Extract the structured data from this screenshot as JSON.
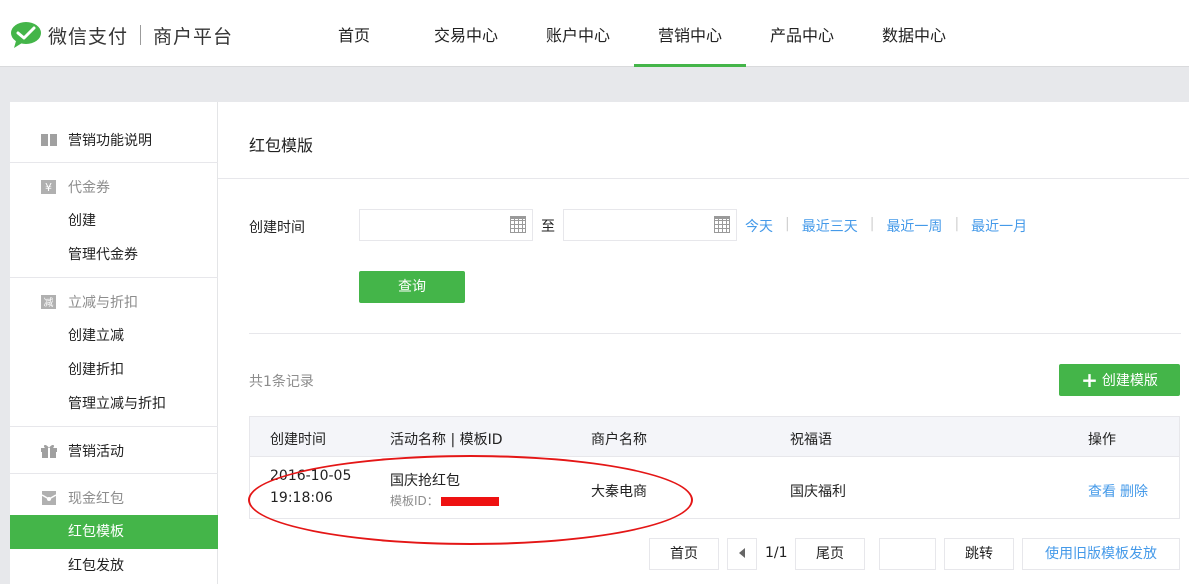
{
  "header": {
    "brand": "微信支付",
    "subtitle": "商户平台",
    "nav": [
      {
        "label": "首页"
      },
      {
        "label": "交易中心"
      },
      {
        "label": "账户中心"
      },
      {
        "label": "营销中心"
      },
      {
        "label": "产品中心"
      },
      {
        "label": "数据中心"
      }
    ],
    "active_nav": "营销中心"
  },
  "sidebar": {
    "marketing_intro": "营销功能说明",
    "voucher": {
      "title": "代金券",
      "items": [
        "创建",
        "管理代金券"
      ]
    },
    "discount": {
      "title": "立减与折扣",
      "items": [
        "创建立减",
        "创建折扣",
        "管理立减与折扣"
      ]
    },
    "activity": "营销活动",
    "cash_redpack": {
      "title": "现金红包",
      "items": [
        "红包模板",
        "红包发放"
      ]
    },
    "active_item": "红包模板"
  },
  "main": {
    "title": "红包模版",
    "filter": {
      "label": "创建时间",
      "start_value": "",
      "end_value": "",
      "to_text": "至",
      "quick": [
        "今天",
        "最近三天",
        "最近一周",
        "最近一月"
      ]
    },
    "query_button": "查询",
    "record_count": "共1条记录",
    "create_button": "创建模版",
    "table": {
      "headers": [
        "创建时间",
        "活动名称 | 模板ID",
        "商户名称",
        "祝福语",
        "操作"
      ],
      "rows": [
        {
          "date": "2016-10-05",
          "time": "19:18:06",
          "activity_name": "国庆抢红包",
          "template_id_label": "模板ID：",
          "merchant": "大秦电商",
          "blessing": "国庆福利",
          "action_view": "查看",
          "action_delete": "删除"
        }
      ]
    },
    "pager": {
      "first": "首页",
      "page_info": "1/1",
      "last": "尾页",
      "jump_value": "",
      "jump": "跳转",
      "old_template": "使用旧版模板发放"
    }
  },
  "colors": {
    "brand_green": "#44b549",
    "link_blue": "#459ae9",
    "annotation_red": "#e41616"
  }
}
